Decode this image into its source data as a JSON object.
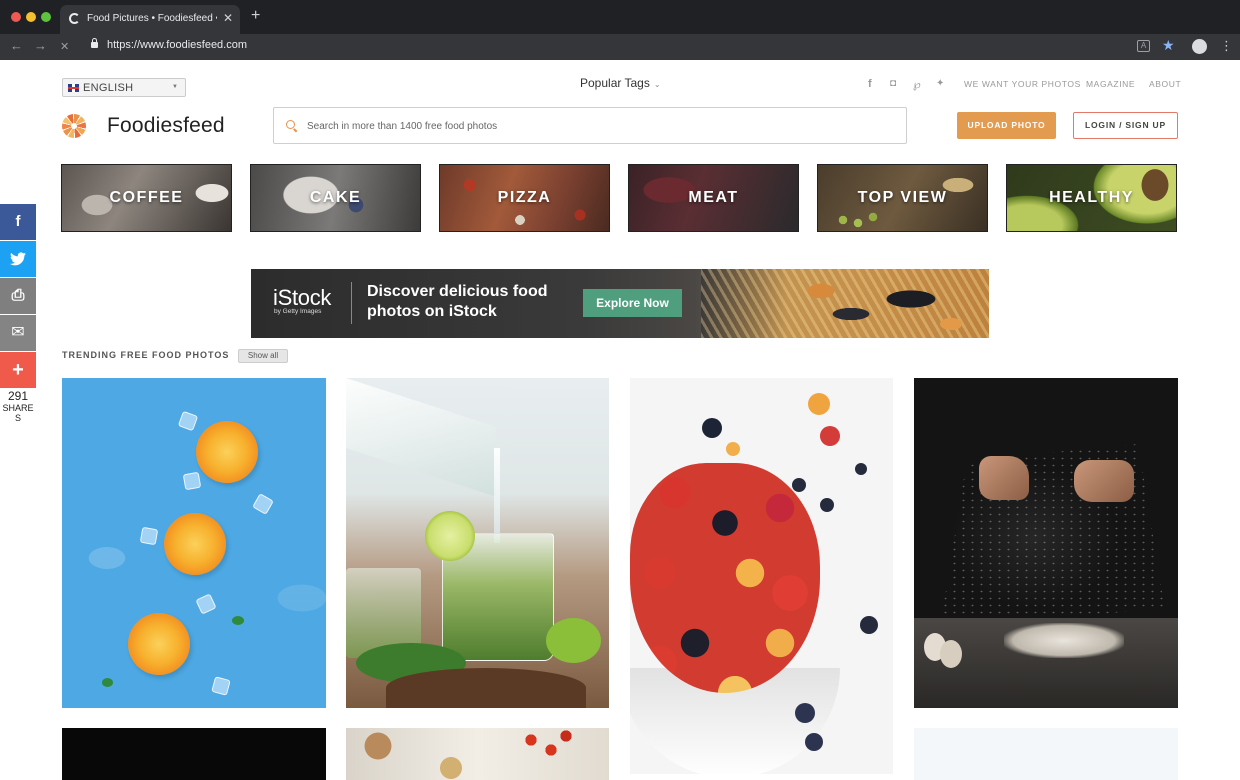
{
  "browser": {
    "tab_title": "Food Pictures • Foodiesfeed •",
    "tab_close": "✕",
    "new_tab": "+",
    "back": "←",
    "forward": "→",
    "reload": "✕",
    "url": "https://www.foodiesfeed.com",
    "star": "★",
    "menu": "⋮"
  },
  "header": {
    "language": "ENGLISH",
    "popular_tags": "Popular Tags",
    "social_icons": [
      "facebook-icon",
      "instagram-icon",
      "pinterest-icon",
      "twitter-icon"
    ],
    "social_glyphs": [
      "f",
      "◘",
      "℘",
      "✦"
    ],
    "links": [
      "WE WANT YOUR PHOTOS",
      "MAGAZINE",
      "ABOUT"
    ],
    "logo_text": "Foodiesfeed",
    "search_placeholder": "Search in more than 1400 free food photos",
    "upload_label": "UPLOAD PHOTO",
    "login_label": "LOGIN / SIGN UP"
  },
  "categories": [
    "COFFEE",
    "CAKE",
    "PIZZA",
    "MEAT",
    "TOP VIEW",
    "HEALTHY"
  ],
  "ad": {
    "brand": "iStock",
    "brand_sub": "by Getty Images",
    "headline": "Discover delicious food photos on iStock",
    "cta": "Explore Now"
  },
  "share": {
    "buttons": [
      "f",
      "🐦",
      "⎙",
      "✉",
      "+"
    ],
    "count": "291",
    "label": "SHARES"
  },
  "trending": {
    "title": "TRENDING FREE FOOD PHOTOS",
    "show_all": "Show all"
  },
  "colors": {
    "accent_orange": "#e39c4f",
    "login_border": "#e27a6a",
    "facebook": "#3b5998",
    "twitter": "#1da1f2",
    "print": "#7f7f7f",
    "email": "#848484",
    "more": "#f05a4a",
    "explore": "#4f9e7e"
  }
}
